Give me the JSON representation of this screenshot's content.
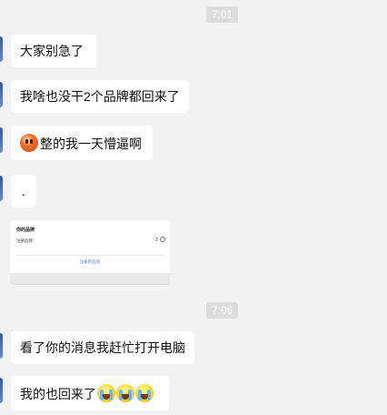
{
  "timestamps": [
    "7:01",
    "7:06"
  ],
  "messages": [
    {
      "text": "大家别急了"
    },
    {
      "text": "我啥也没干2个品牌都回来了"
    },
    {
      "text": "整的我一天懵逼啊",
      "emoji": "orange-face-icon"
    },
    {
      "text": "."
    },
    {
      "type": "image-card",
      "title": "你的品牌",
      "row_label": "注册品牌",
      "count": "2",
      "link_text": "注册新品牌"
    },
    {
      "text": "看了你的消息我赶忙打开电脑"
    },
    {
      "text": "我的也回来了",
      "emoji": "crying-face-icon"
    }
  ]
}
